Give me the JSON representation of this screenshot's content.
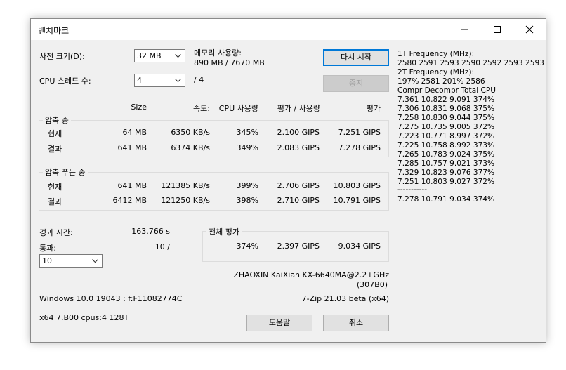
{
  "window": {
    "title": "벤치마크"
  },
  "settings": {
    "dict_label": "사전 크기(D):",
    "dict_value": "32 MB",
    "threads_label": "CPU 스레드 수:",
    "threads_value": "4",
    "threads_of": "/ 4",
    "memory_label": "메모리 사용량:",
    "memory_value": "890 MB / 7670 MB"
  },
  "buttons": {
    "restart": "다시 시작",
    "stop": "중지",
    "help": "도움말",
    "cancel": "취소"
  },
  "table": {
    "headers": {
      "size": "Size",
      "speed": "속도:",
      "cpu": "CPU 사용량",
      "rating_usage": "평가 / 사용량",
      "rating": "평가"
    },
    "compress": {
      "title": "압축 중",
      "rows": [
        {
          "label": "현재",
          "size": "64 MB",
          "speed": "6350 KB/s",
          "cpu": "345%",
          "ru": "2.100 GIPS",
          "rating": "7.251 GIPS"
        },
        {
          "label": "결과",
          "size": "641 MB",
          "speed": "6374 KB/s",
          "cpu": "349%",
          "ru": "2.083 GIPS",
          "rating": "7.278 GIPS"
        }
      ]
    },
    "decompress": {
      "title": "압축 푸는 중",
      "rows": [
        {
          "label": "현재",
          "size": "641 MB",
          "speed": "121385 KB/s",
          "cpu": "399%",
          "ru": "2.706 GIPS",
          "rating": "10.803 GIPS"
        },
        {
          "label": "결과",
          "size": "6412 MB",
          "speed": "121250 KB/s",
          "cpu": "398%",
          "ru": "2.710 GIPS",
          "rating": "10.791 GIPS"
        }
      ]
    }
  },
  "elapsed": {
    "label": "경과 시간:",
    "value": "163.766 s"
  },
  "passes": {
    "label": "통과:",
    "value": "10 /",
    "select_value": "10"
  },
  "total": {
    "title": "전체 평가",
    "cpu": "374%",
    "ru": "2.397 GIPS",
    "rating": "9.034 GIPS"
  },
  "cpu_info": {
    "line1": "ZHAOXIN KaiXian KX-6640MA@2.2+GHz",
    "line2": "(307B0)"
  },
  "os_info": "Windows 10.0 19043 : f:F11082774C",
  "version": "7-Zip 21.03 beta (x64)",
  "build_info": "x64 7.B00 cpus:4 128T",
  "side_log": {
    "lines": [
      "1T Frequency (MHz):",
      " 2580 2591 2593 2590 2592 2593 2593",
      "2T Frequency (MHz):",
      " 197% 2581 201% 2586",
      "Compr Decompr Total  CPU",
      "7.361  10.822  9.091   374%",
      "7.306  10.831  9.068   375%",
      "7.258  10.830  9.044   375%",
      "7.275  10.735  9.005   372%",
      "7.223  10.771  8.997   372%",
      "7.225  10.758  8.992   373%",
      "7.265  10.783  9.024   375%",
      "7.285  10.757  9.021   373%",
      "7.329  10.823  9.076   377%",
      "7.251  10.803  9.027   372%",
      "-----------",
      "7.278  10.791  9.034   374%"
    ]
  }
}
